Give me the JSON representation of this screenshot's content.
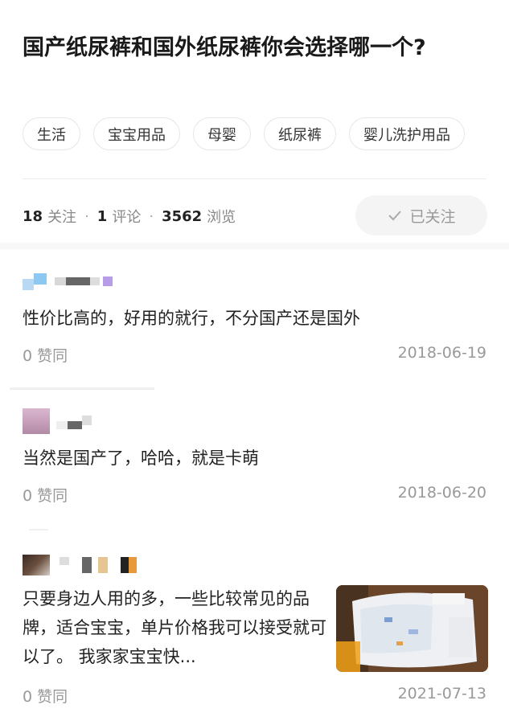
{
  "question": {
    "title": "国产纸尿裤和国外纸尿裤你会选择哪一个?"
  },
  "tags": [
    "生活",
    "宝宝用品",
    "母婴",
    "纸尿裤",
    "婴儿洗护用品"
  ],
  "stats": {
    "followers_count": "18",
    "followers_label": "关注",
    "comments_count": "1",
    "comments_label": "评论",
    "views_count": "3562",
    "views_label": "浏览",
    "separator": "·"
  },
  "follow_button": {
    "label": "已关注",
    "icon": "check-icon"
  },
  "answers": [
    {
      "content": "性价比高的，好用的就行，不分国产还是国外",
      "likes": "0 赞同",
      "date": "2018-06-19"
    },
    {
      "content": "当然是国产了，哈哈，就是卡萌",
      "likes": "0 赞同",
      "date": "2018-06-20"
    },
    {
      "content": "只要身边人用的多，一些比较常见的品牌，适合宝宝，单片价格我可以接受就可以了。 我家家宝宝快...",
      "likes": "0 赞同",
      "date": "2021-07-13"
    }
  ],
  "colors": {
    "accent_gray": "#999999",
    "tag_border": "#e6e6e6",
    "button_bg": "#f4f4f5"
  }
}
